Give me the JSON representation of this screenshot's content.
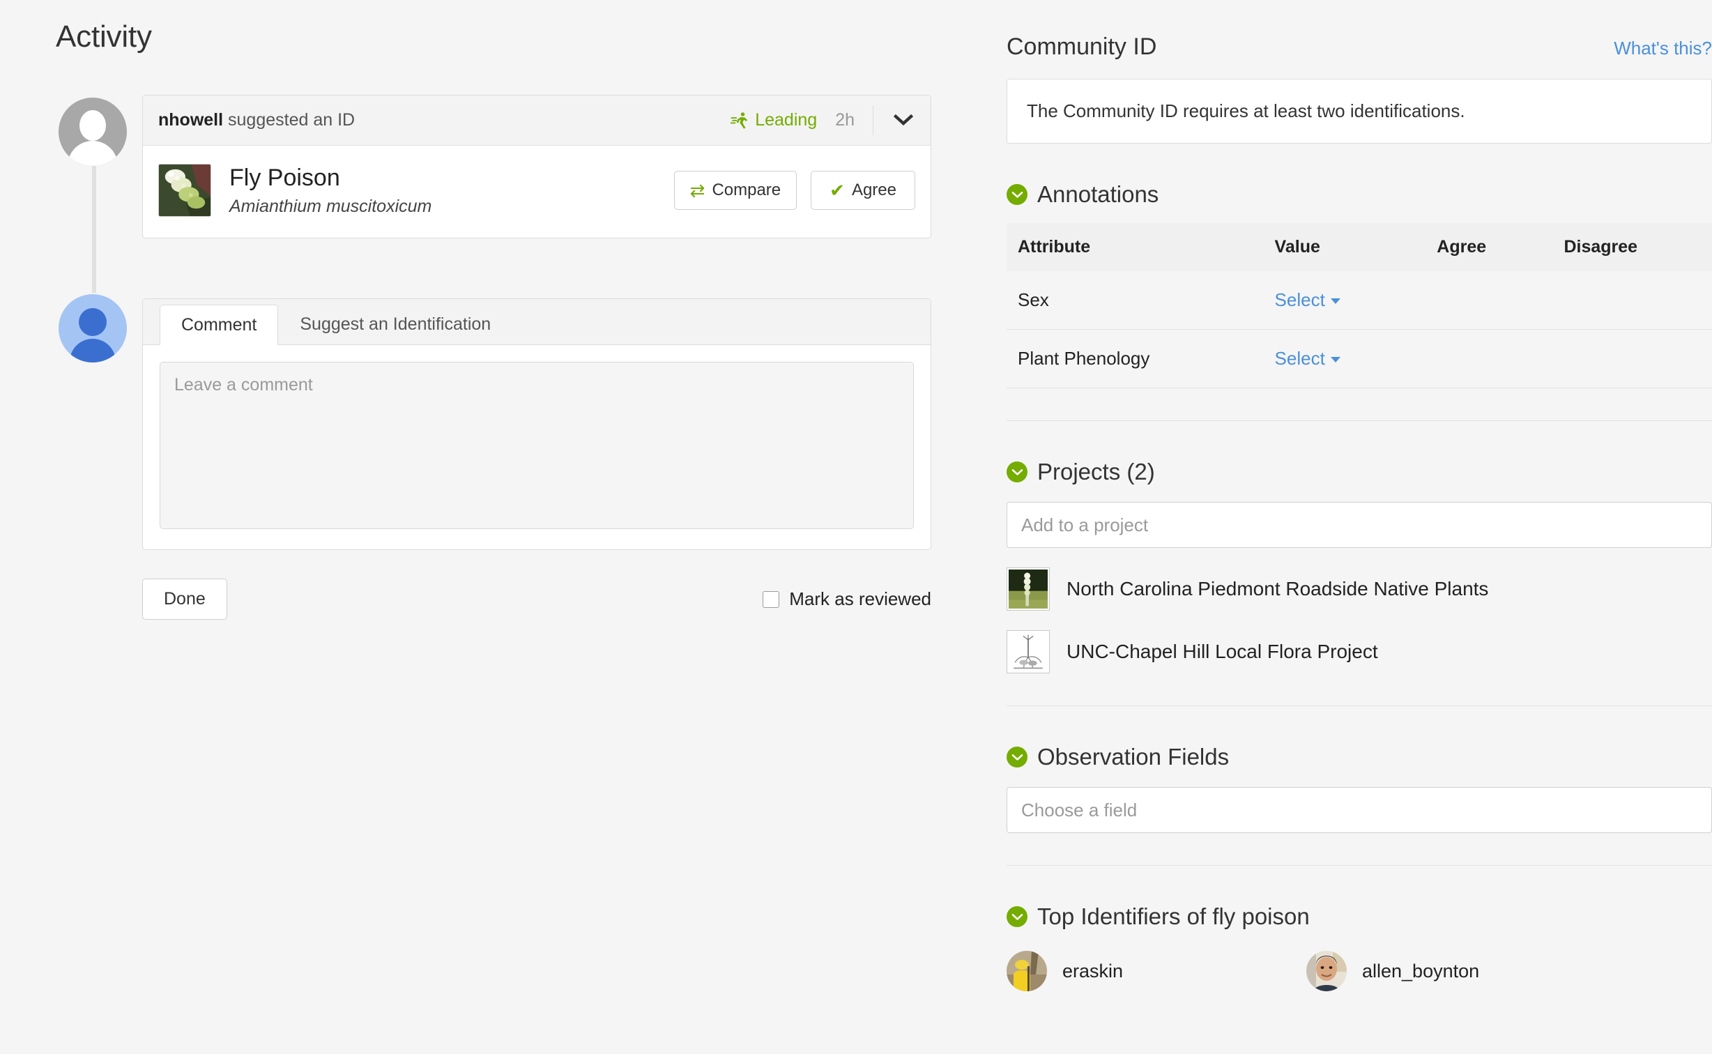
{
  "left": {
    "heading": "Activity",
    "identification": {
      "user": "nhowell",
      "action_text": " suggested an ID",
      "status_badge": "Leading",
      "status_icon": "runner-icon",
      "time_ago": "2h",
      "expand_icon": "chevron-down-icon",
      "taxon_common_name": "Fly Poison",
      "taxon_scientific_name": "Amianthium muscitoxicum",
      "compare_label": "Compare",
      "compare_icon": "exchange-arrows-icon",
      "agree_label": "Agree",
      "agree_icon": "check-icon"
    },
    "tabs": [
      {
        "label": "Comment",
        "active": true
      },
      {
        "label": "Suggest an Identification",
        "active": false
      }
    ],
    "comment_placeholder": "Leave a comment",
    "comment_value": "",
    "done_label": "Done",
    "mark_reviewed_label": "Mark as reviewed",
    "mark_reviewed_checked": false
  },
  "right": {
    "community_id": {
      "title": "Community ID",
      "help_link": "What's this?",
      "message": "The Community ID requires at least two identifications."
    },
    "annotations": {
      "title": "Annotations",
      "columns": [
        "Attribute",
        "Value",
        "Agree",
        "Disagree"
      ],
      "rows": [
        {
          "attribute": "Sex",
          "value": "Select",
          "agree": "",
          "disagree": ""
        },
        {
          "attribute": "Plant Phenology",
          "value": "Select",
          "agree": "",
          "disagree": ""
        }
      ]
    },
    "projects": {
      "title": "Projects (2)",
      "add_placeholder": "Add to a project",
      "items": [
        {
          "name": "North Carolina Piedmont Roadside Native Plants",
          "thumb": "photo-plant-field"
        },
        {
          "name": "UNC-Chapel Hill Local Flora Project",
          "thumb": "botanical-line-drawing"
        }
      ]
    },
    "observation_fields": {
      "title": "Observation Fields",
      "choose_placeholder": "Choose a field"
    },
    "top_identifiers": {
      "title": "Top Identifiers of fly poison",
      "users": [
        {
          "name": "eraskin",
          "avatar": "photo-firefighter-yellow"
        },
        {
          "name": "allen_boynton",
          "avatar": "photo-man-portrait"
        }
      ]
    }
  },
  "colors": {
    "page_bg": "#f5f5f5",
    "accent_green": "#74ac00",
    "link_blue": "#4a90d9",
    "border": "#dcdcdc"
  }
}
